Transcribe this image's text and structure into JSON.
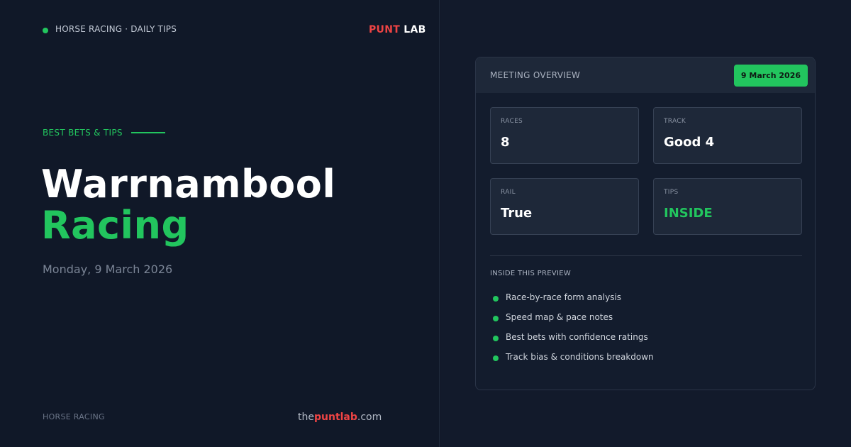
{
  "header": {
    "eyebrow": "HORSE RACING · DAILY TIPS",
    "brand_punt": "PUNT",
    "brand_lab": "LAB"
  },
  "hero": {
    "kicker": "BEST BETS & TIPS",
    "title_line1": "Warrnambool",
    "title_line2": "Racing",
    "date": "Monday, 9 March 2026"
  },
  "footer": {
    "category": "HORSE RACING",
    "site_pre": "the",
    "site_mid": "puntlab",
    "site_post": ".com"
  },
  "overview": {
    "heading": "MEETING OVERVIEW",
    "date_badge": "9 March 2026",
    "stats": [
      {
        "label": "RACES",
        "value": "8"
      },
      {
        "label": "TRACK",
        "value": "Good 4"
      },
      {
        "label": "RAIL",
        "value": "True"
      },
      {
        "label": "TIPS",
        "value": "INSIDE"
      }
    ],
    "inside_label": "INSIDE THIS PREVIEW",
    "bullets": [
      "Race-by-race form analysis",
      "Speed map & pace notes",
      "Best bets with confidence ratings",
      "Track bias & conditions breakdown"
    ]
  },
  "colors": {
    "accent": "#22c55e",
    "brand_red": "#ef4444",
    "background": "#111827"
  }
}
